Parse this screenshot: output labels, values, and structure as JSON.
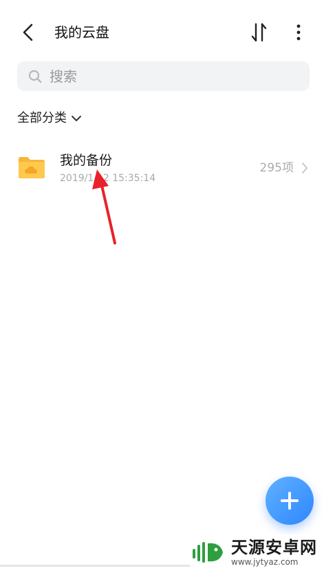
{
  "header": {
    "title": "我的云盘",
    "back_icon": "back-arrow-icon",
    "sort_icon": "sort-arrows-icon",
    "more_icon": "more-vertical-icon"
  },
  "search": {
    "placeholder": "搜索",
    "icon": "search-icon"
  },
  "filter": {
    "label": "全部分类",
    "icon": "chevron-down-icon"
  },
  "files": [
    {
      "name": "我的备份",
      "date": "2019/1/12 15:35:14",
      "count": "295项",
      "icon": "cloud-folder-icon"
    }
  ],
  "fab": {
    "icon": "plus-icon"
  },
  "watermark": {
    "title": "天源安卓网",
    "url": "www.jytyaz.com"
  },
  "colors": {
    "accent": "#2f86ff",
    "folder": "#ffc44d",
    "annotation": "#e8222b",
    "search_bg": "#f2f3f5"
  }
}
